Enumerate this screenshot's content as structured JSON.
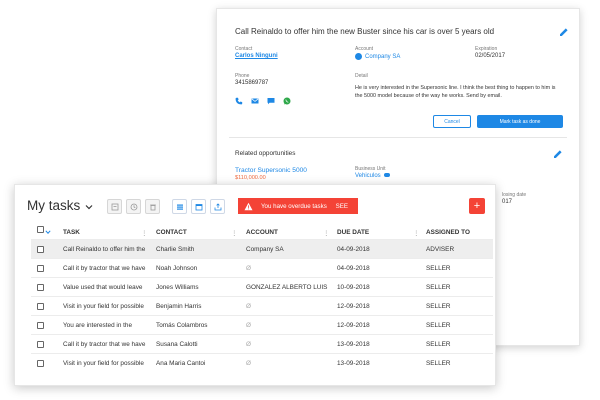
{
  "detail": {
    "title": "Call Reinaldo to offer him the new Buster since his car is over 5 years old",
    "contact_label": "Contact",
    "contact_value": "Carlos Ninguni",
    "account_label": "Account",
    "account_value": "Company SA",
    "expiration_label": "Expiration",
    "expiration_value": "02/05/2017",
    "phone_label": "Phone",
    "phone_value": "3415869787",
    "detail_label": "Detail",
    "detail_text": "He is very interested in the Supersonic line. I think the best thing to happen to him is the 5000 model because of the way he works. Send by email.",
    "cancel_label": "Cancel",
    "mark_done_label": "Mark task as done",
    "related_title": "Related opportunities",
    "opportunity_name": "Tractor Supersonic 5000",
    "opportunity_amount": "$110,000.00",
    "business_unit_label": "Business Unit",
    "business_unit_value": "Vehiculos",
    "closing_label": "losing date",
    "closing_value": "017"
  },
  "tasks": {
    "title": "My tasks",
    "alert_text": "You have overdue tasks",
    "alert_action": "SEE",
    "add_label": "+",
    "columns": [
      "TASK",
      "CONTACT",
      "ACCOUNT",
      "DUE DATE",
      "ASSIGNED TO"
    ],
    "empty_mark": "Ø",
    "rows": [
      {
        "task": "Call Reinaldo to offer him the",
        "contact": "Charlie Smith",
        "account": "Company SA",
        "due": "04-09-2018",
        "assigned": "ADVISER"
      },
      {
        "task": "Call it by tractor that we have",
        "contact": "Noah Johnson",
        "account": "Ø",
        "due": "04-09-2018",
        "assigned": "SELLER"
      },
      {
        "task": "Value used that would leave",
        "contact": "Jones Williams",
        "account": "GONZALEZ ALBERTO LUIS",
        "due": "10-09-2018",
        "assigned": "SELLER"
      },
      {
        "task": "Visit in your field for possible",
        "contact": "Benjamin Harris",
        "account": "Ø",
        "due": "12-09-2018",
        "assigned": "SELLER"
      },
      {
        "task": "You are interested in the",
        "contact": "Tomás Colambros",
        "account": "Ø",
        "due": "12-09-2018",
        "assigned": "SELLER"
      },
      {
        "task": "Call it by tractor that we have",
        "contact": "Susana Calotti",
        "account": "Ø",
        "due": "13-09-2018",
        "assigned": "SELLER"
      },
      {
        "task": "Visit in your field for possible",
        "contact": "Ana Maria Cantoi",
        "account": "Ø",
        "due": "13-09-2018",
        "assigned": "SELLER"
      }
    ]
  },
  "colors": {
    "accent": "#1e88e5",
    "alert": "#f44336",
    "amount": "#f06b3f"
  }
}
